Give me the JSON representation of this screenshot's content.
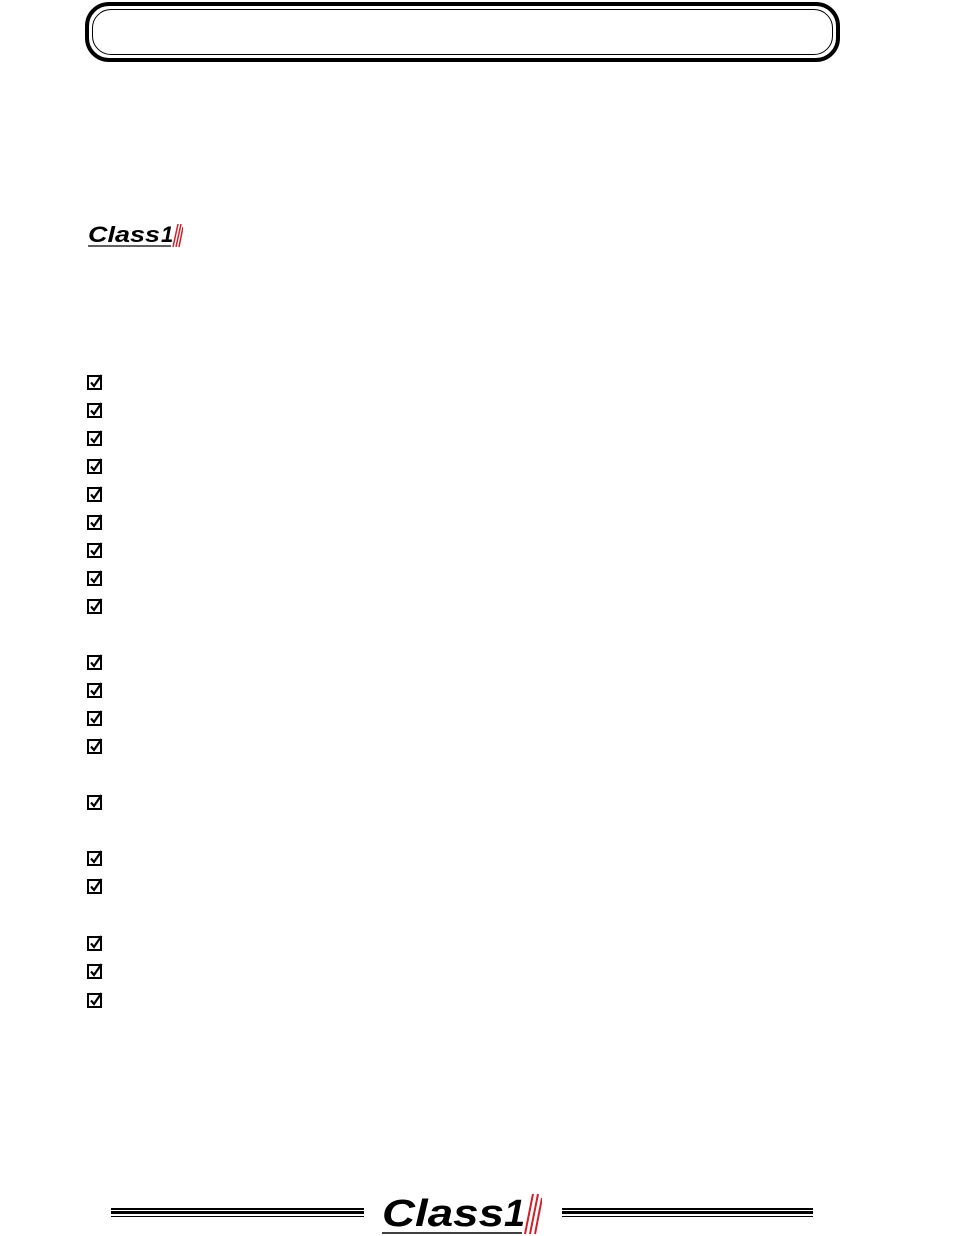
{
  "header": {
    "title": ""
  },
  "brand": {
    "logo_text": "Class",
    "logo_numeral": "1",
    "text_color": "#000000",
    "stripe_color": "#d0202a"
  },
  "checklist": {
    "items": [
      {
        "checked": true,
        "label": ""
      },
      {
        "checked": true,
        "label": ""
      },
      {
        "checked": true,
        "label": ""
      },
      {
        "checked": true,
        "label": ""
      },
      {
        "checked": true,
        "label": ""
      },
      {
        "checked": true,
        "label": ""
      },
      {
        "checked": true,
        "label": ""
      },
      {
        "checked": true,
        "label": ""
      },
      {
        "checked": true,
        "label": ""
      },
      {
        "checked": true,
        "label": ""
      },
      {
        "checked": true,
        "label": ""
      },
      {
        "checked": true,
        "label": ""
      },
      {
        "checked": true,
        "label": ""
      },
      {
        "checked": true,
        "label": ""
      },
      {
        "checked": true,
        "label": ""
      },
      {
        "checked": true,
        "label": ""
      },
      {
        "checked": true,
        "label": ""
      },
      {
        "checked": true,
        "label": ""
      },
      {
        "checked": true,
        "label": ""
      }
    ]
  },
  "footer": {
    "logo_text": "Class",
    "logo_numeral": "1"
  }
}
